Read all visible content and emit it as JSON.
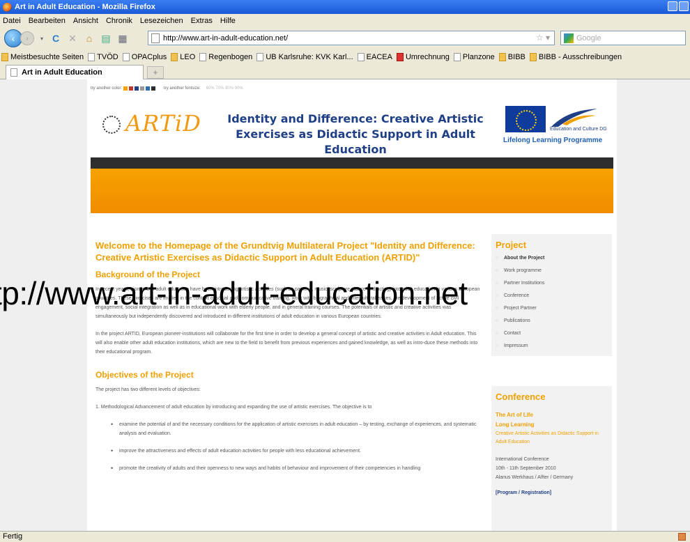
{
  "window": {
    "title": "Art in Adult Education - Mozilla Firefox"
  },
  "menu": [
    "Datei",
    "Bearbeiten",
    "Ansicht",
    "Chronik",
    "Lesezeichen",
    "Extras",
    "Hilfe"
  ],
  "nav": {
    "url": "http://www.art-in-adult-education.net/",
    "search_placeholder": "Google"
  },
  "bookmarks": [
    "Meistbesuchte Seiten",
    "TVÖD",
    "OPACplus",
    "LEO",
    "Regenbogen",
    "UB Karlsruhe: KVK Karl...",
    "EACEA",
    "Umrechnung",
    "Planzone",
    "BIBB",
    "BIBB - Ausschreibungen"
  ],
  "tab": {
    "label": "Art in Adult Education",
    "new_tab": "+"
  },
  "site": {
    "options": {
      "color_label": "try another color:",
      "size_label": "try another fontsize:",
      "sizes": "60% 70% 80% 90%",
      "swatches": [
        "#f7a200",
        "#c0392b",
        "#1f3f86",
        "#999999",
        "#2d6fb3",
        "#2d2d2d"
      ]
    },
    "logo": "ARTiD",
    "header_title": "Identity and Difference: Creative Artistic Exercises as Didactic Support in Adult Education",
    "eu_sub": "Education and Culture DG",
    "llp": "Lifelong Learning Programme",
    "welcome": "Welcome to the Homepage of the Grundtvig Multilateral Project \"Identity and Difference: Creative Artistic Exercises as Didactic Support in Adult Education (ARTID)\"",
    "sub_heading": "Background of the Project",
    "p1": "In recent years, pioneers in adult education have been introducing artistic activities (such as painting, music, sculpture, dance and acting) into adult education in various European countries. These exercises are implied in the context of social and communicative training, work with biographical and intercultural issues, the development of active civil engagement, social integration as well as in educational work with elderly people, and in general training courses. The potentials of artistic and creative activities was simultaneously but independently discovered and introduced in different institutions of adult education in various European countries.",
    "p2": "In the project ARTID, European pioneer-institutions will collaborate for the first time in order to develop a general concept of artistic and creative activities in Adult education. This will also enable other adult education institutions, which are new to the field to benefit from previous experiences and gained knowledge, as well as intro-duce these methods into their educational program.",
    "h_objectives": "Objectives of the Project",
    "p3": "The project has two different levels of objectives:",
    "p4": "1. Methodological Advancement of adult education by introducing and expanding the use of artistic exercises. The objective is to",
    "b1": "examine the potential of and the necessary conditions for the application of artistic exercises in adult education – by testing, exchange of experiences, and systematic analysis and evaluation.",
    "b2": "improve the attractiveness and effects of adult education activities for people with less educational achievement.",
    "b3": "promote the creativity of adults and their openness to new ways and habits of behaviour and improvement of their competencies in handling",
    "sidebar": {
      "heading": "Project",
      "items": [
        "About the Project",
        "Work programme",
        "Partner Institutions",
        "Conference",
        "Project Partner",
        "Publications",
        "Contact",
        "Impressum"
      ]
    },
    "conference": {
      "heading": "Conference",
      "title1": "The Art of Life",
      "title2": "Long Learning",
      "subtitle": "Creative Artistic Activities as Didactic Support in Adult Education",
      "details": "International Conference",
      "dates": "10th - 11th September 2010",
      "place": "Alanus Werkhaus / Alfter / Germany",
      "link": "[Program / Registration]"
    }
  },
  "overlay": "tp://www.art-in-adult-education.net",
  "status": "Fertig"
}
